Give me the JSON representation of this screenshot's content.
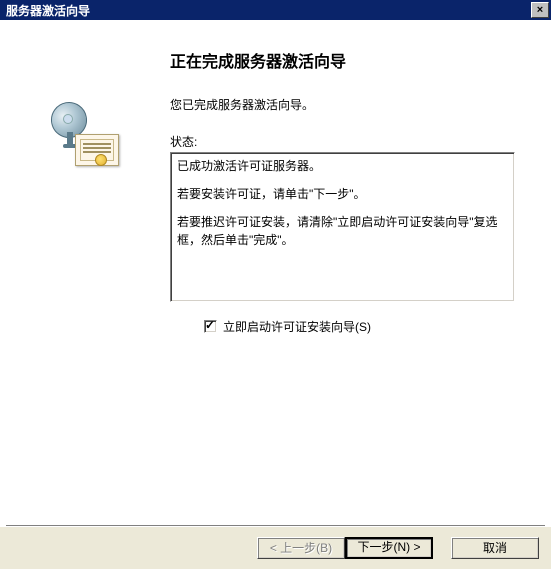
{
  "title_bar": {
    "title": "服务器激活向导",
    "close": "×"
  },
  "wizard": {
    "heading": "正在完成服务器激活向导",
    "completed_text": "您已完成服务器激活向导。",
    "status_label": "状态:",
    "status_lines": {
      "line1": "已成功激活许可证服务器。",
      "line2": "若要安装许可证，请单击\"下一步\"。",
      "line3": "若要推迟许可证安装，请清除\"立即启动许可证安装向导\"复选框，然后单击\"完成\"。"
    },
    "checkbox_label": "立即启动许可证安装向导(S)",
    "checkbox_checked": true
  },
  "buttons": {
    "back": "< 上一步(B)",
    "next": "下一步(N) >",
    "cancel": "取消"
  }
}
